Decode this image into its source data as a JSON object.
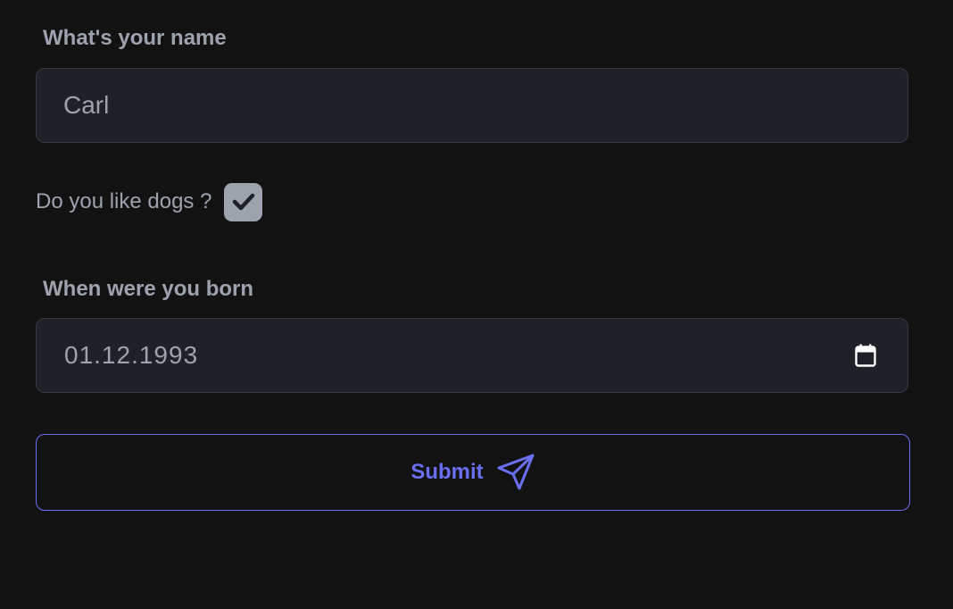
{
  "name_field": {
    "label": "What's your name",
    "value": "Carl"
  },
  "dogs_question": {
    "label": "Do you like dogs ?",
    "checked": true
  },
  "birth_field": {
    "label": "When were you born",
    "value": "01.12.1993",
    "icon": "calendar-icon"
  },
  "submit": {
    "label": "Submit",
    "icon": "send-icon"
  },
  "colors": {
    "background": "#121212",
    "field_background": "#1f2128",
    "text": "#9ca3af",
    "accent": "#6a6ff0"
  }
}
